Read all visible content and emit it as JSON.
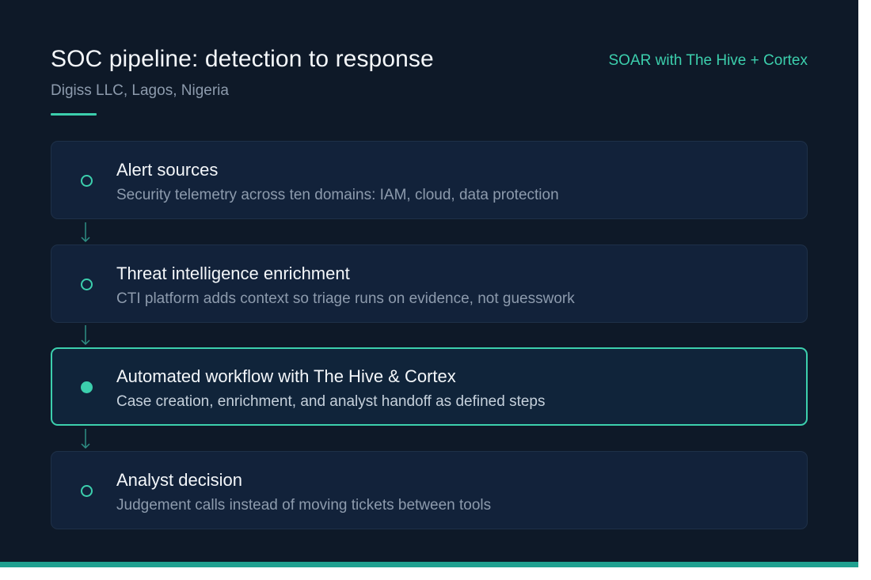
{
  "header": {
    "title": "SOC pipeline: detection to response",
    "subtitle": "Digiss LLC, Lagos, Nigeria",
    "tagline": "SOAR with The Hive + Cortex"
  },
  "steps": [
    {
      "title": "Alert sources",
      "description": "Security telemetry across ten domains: IAM, cloud, data protection",
      "active": false
    },
    {
      "title": "Threat intelligence enrichment",
      "description": "CTI platform adds context so triage runs on evidence, not guesswork",
      "active": false
    },
    {
      "title": "Automated workflow with The Hive & Cortex",
      "description": "Case creation, enrichment, and analyst handoff as defined steps",
      "active": true
    },
    {
      "title": "Analyst decision",
      "description": "Judgement calls instead of moving tickets between tools",
      "active": false
    }
  ],
  "colors": {
    "background": "#0e1928",
    "card": "#12223a",
    "accent": "#3ccfad",
    "bottom_bar": "#20a090"
  }
}
